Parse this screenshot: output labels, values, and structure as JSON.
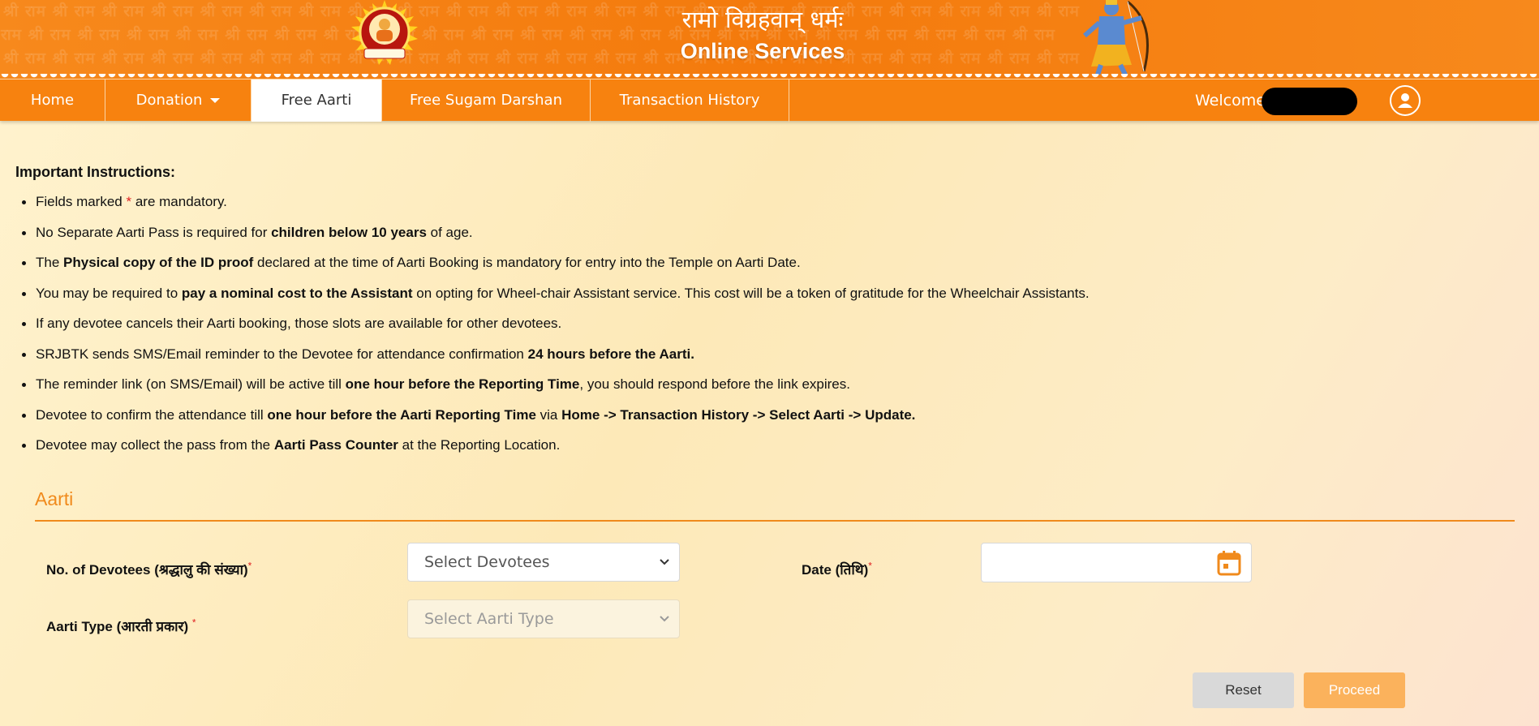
{
  "header": {
    "motto": "रामो विग्रहवान् धर्मः",
    "title": "Online Services",
    "watermark_text": "श्री राम श्री राम श्री राम श्री राम श्री राम श्री राम श्री राम श्री राम श्री राम श्री राम श्री राम श्री राम श्री राम श्री राम श्री राम श्री राम श्री राम श्री राम श्री राम श्री राम श्री राम श्री राम",
    "logo_icon": "temple-trust-seal",
    "hero_icon": "shri-ram-with-bow"
  },
  "nav": {
    "items": [
      {
        "label": "Home"
      },
      {
        "label": "Donation"
      },
      {
        "label": "Free Aarti"
      },
      {
        "label": "Free Sugam Darshan"
      },
      {
        "label": "Transaction History"
      }
    ],
    "active": "Free Aarti",
    "welcome": "Welcome"
  },
  "instructions": {
    "title": "Important Instructions:",
    "items": [
      {
        "parts": [
          {
            "t": "Fields marked "
          },
          {
            "t": "*",
            "req": true
          },
          {
            "t": " are mandatory."
          }
        ]
      },
      {
        "parts": [
          {
            "t": "No Separate Aarti Pass is required for "
          },
          {
            "t": "children below 10 years",
            "b": true
          },
          {
            "t": " of age."
          }
        ]
      },
      {
        "parts": [
          {
            "t": "The "
          },
          {
            "t": "Physical copy of the ID proof",
            "b": true
          },
          {
            "t": " declared at the time of Aarti Booking is mandatory for entry into the Temple on Aarti Date."
          }
        ]
      },
      {
        "parts": [
          {
            "t": "You may be required to "
          },
          {
            "t": "pay a nominal cost to the Assistant",
            "b": true
          },
          {
            "t": " on opting for Wheel-chair Assistant service. This cost will be a token of gratitude for the Wheelchair Assistants."
          }
        ]
      },
      {
        "parts": [
          {
            "t": "If any devotee cancels their Aarti booking, those slots are available for other devotees."
          }
        ]
      },
      {
        "parts": [
          {
            "t": "SRJBTK sends SMS/Email reminder to the Devotee for attendance confirmation "
          },
          {
            "t": "24 hours before the Aarti.",
            "b": true
          }
        ]
      },
      {
        "parts": [
          {
            "t": "The reminder link (on SMS/Email) will be active till "
          },
          {
            "t": "one hour before the Reporting Time",
            "b": true
          },
          {
            "t": ", you should respond before the link expires."
          }
        ]
      },
      {
        "parts": [
          {
            "t": "Devotee to confirm the attendance till "
          },
          {
            "t": "one hour before the Aarti Reporting Time",
            "b": true
          },
          {
            "t": " via "
          },
          {
            "t": "Home -> Transaction History -> Select Aarti -> Update.",
            "b": true
          }
        ]
      },
      {
        "parts": [
          {
            "t": "Devotee may collect the pass from the "
          },
          {
            "t": "Aarti Pass Counter",
            "b": true
          },
          {
            "t": " at the Reporting Location."
          }
        ]
      }
    ]
  },
  "form": {
    "section_title": "Aarti",
    "devotees_label": "No. of Devotees (श्रद्धालु की संख्या)",
    "devotees_placeholder": "Select Devotees",
    "date_label": "Date (तिथि)",
    "date_value": "",
    "aarti_type_label": "Aarti Type (आरती प्रकार)",
    "aarti_type_placeholder": "Select Aarti Type",
    "required_mark": "*",
    "reset_label": "Reset",
    "proceed_label": "Proceed"
  },
  "colors": {
    "header_orange": "#f47a0c",
    "nav_orange": "#f7820f",
    "accent": "#f08a1c",
    "required": "#e02020",
    "proceed_bg": "#fbb25c",
    "reset_bg": "#d9d9d9"
  }
}
